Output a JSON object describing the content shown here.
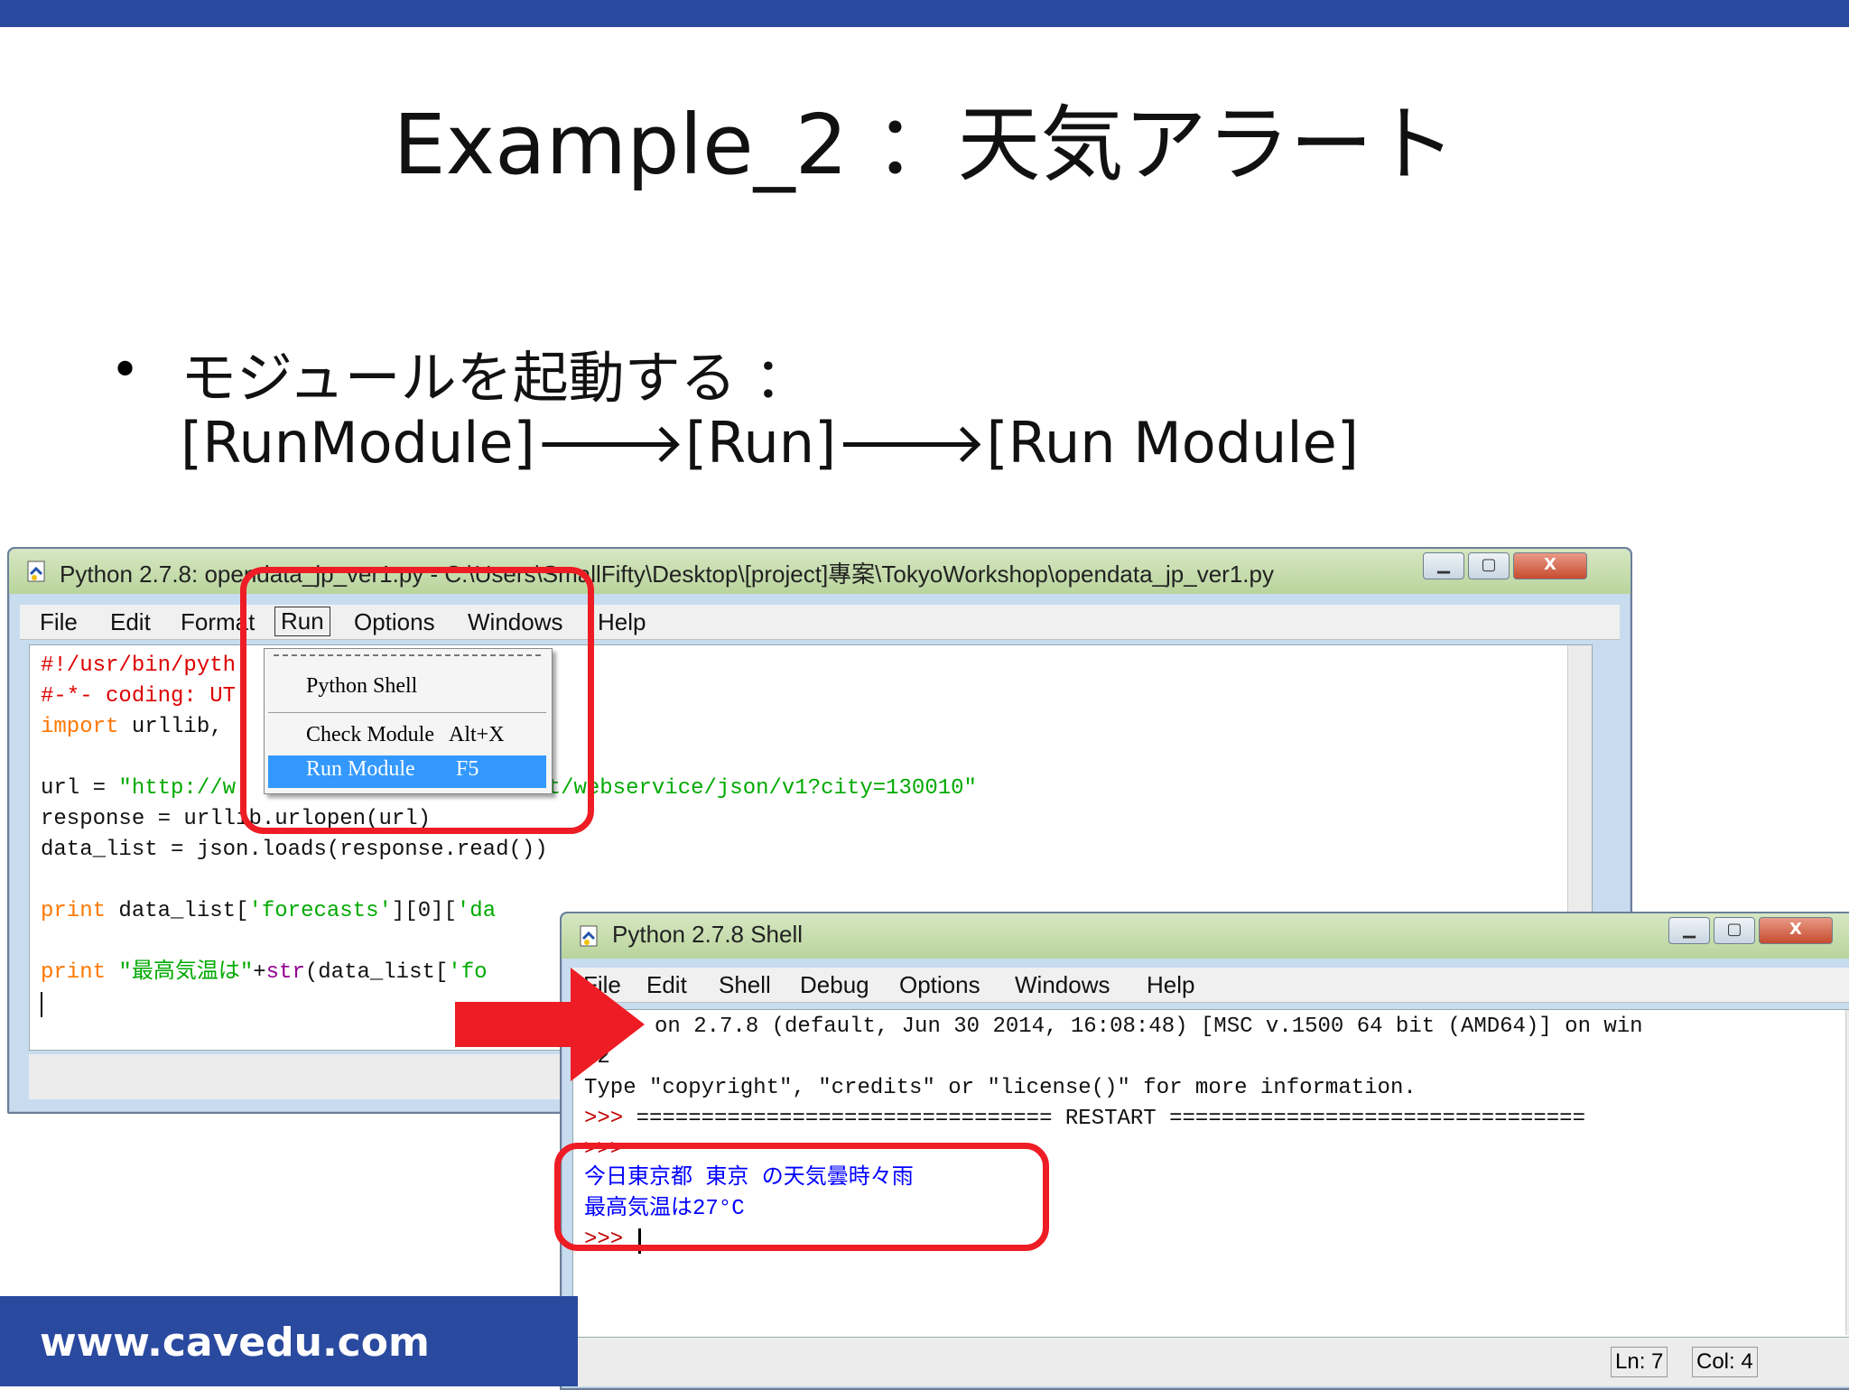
{
  "slide": {
    "title": "Example_2 ：天気アラート",
    "bullet_dot": "•",
    "bullet_line1": "モジュールを起動する ：",
    "bullet_line2": "[RunModule]🡒[Run]🡒[Run Module]",
    "footer": "www.cavedu.com",
    "accent_color": "#2a4aa0"
  },
  "editor_window": {
    "title": "Python 2.7.8: opendata_jp_ver1.py - C:\\Users\\SmallFifty\\Desktop\\[project]專案\\TokyoWorkshop\\opendata_jp_ver1.py",
    "menu": [
      "File",
      "Edit",
      "Format",
      "Run",
      "Options",
      "Windows",
      "Help"
    ],
    "code": {
      "l1": "#!/usr/bin/pyth",
      "l2": "#-*- coding: UT",
      "l3_kw": "import",
      "l3_rest": " urllib,",
      "l5_a": "url = ",
      "l5_s": "\"http://w",
      "l5_s2": "n/forecast/webservice/json/v1?city=130010\"",
      "l6": "response = urllib.urlopen(url)",
      "l7": "data_list = json.loads(response.read())",
      "l9_kw": "print",
      "l9_a": " data_list[",
      "l9_s": "'forecasts'",
      "l9_b": "][0][",
      "l9_s2": "'da",
      "l11_kw": "print",
      "l11_s": " \"最高気温は\"",
      "l11_a": "+",
      "l11_bi": "str",
      "l11_b": "(data_list[",
      "l11_s2": "'fo"
    },
    "run_menu": {
      "items": [
        "Python Shell",
        "Check Module",
        "Run Module"
      ],
      "shortcuts": [
        "",
        "Alt+X",
        "F5"
      ],
      "selected": "Run Module"
    }
  },
  "shell_window": {
    "title": "Python 2.7.8 Shell",
    "menu": [
      "File",
      "Edit",
      "Shell",
      "Debug",
      "Options",
      "Windows",
      "Help"
    ],
    "lines": {
      "l1": "on 2.7.8 (default, Jun 30 2014, 16:08:48) [MSC v.1500 64 bit (AMD64)] on win",
      "l2": "32",
      "l3": "Type \"copyright\", \"credits\" or \"license()\" for more information.",
      "l4_prompt": ">>> ",
      "l4_rest": "================================ RESTART ================================",
      "l5_prompt": ">>> ",
      "l6": "今日東京都 東京 の天気曇時々雨",
      "l7": "最高気温は27°C",
      "l8_prompt": ">>> "
    },
    "status": {
      "ln": "Ln: 7",
      "col": "Col: 4"
    }
  }
}
